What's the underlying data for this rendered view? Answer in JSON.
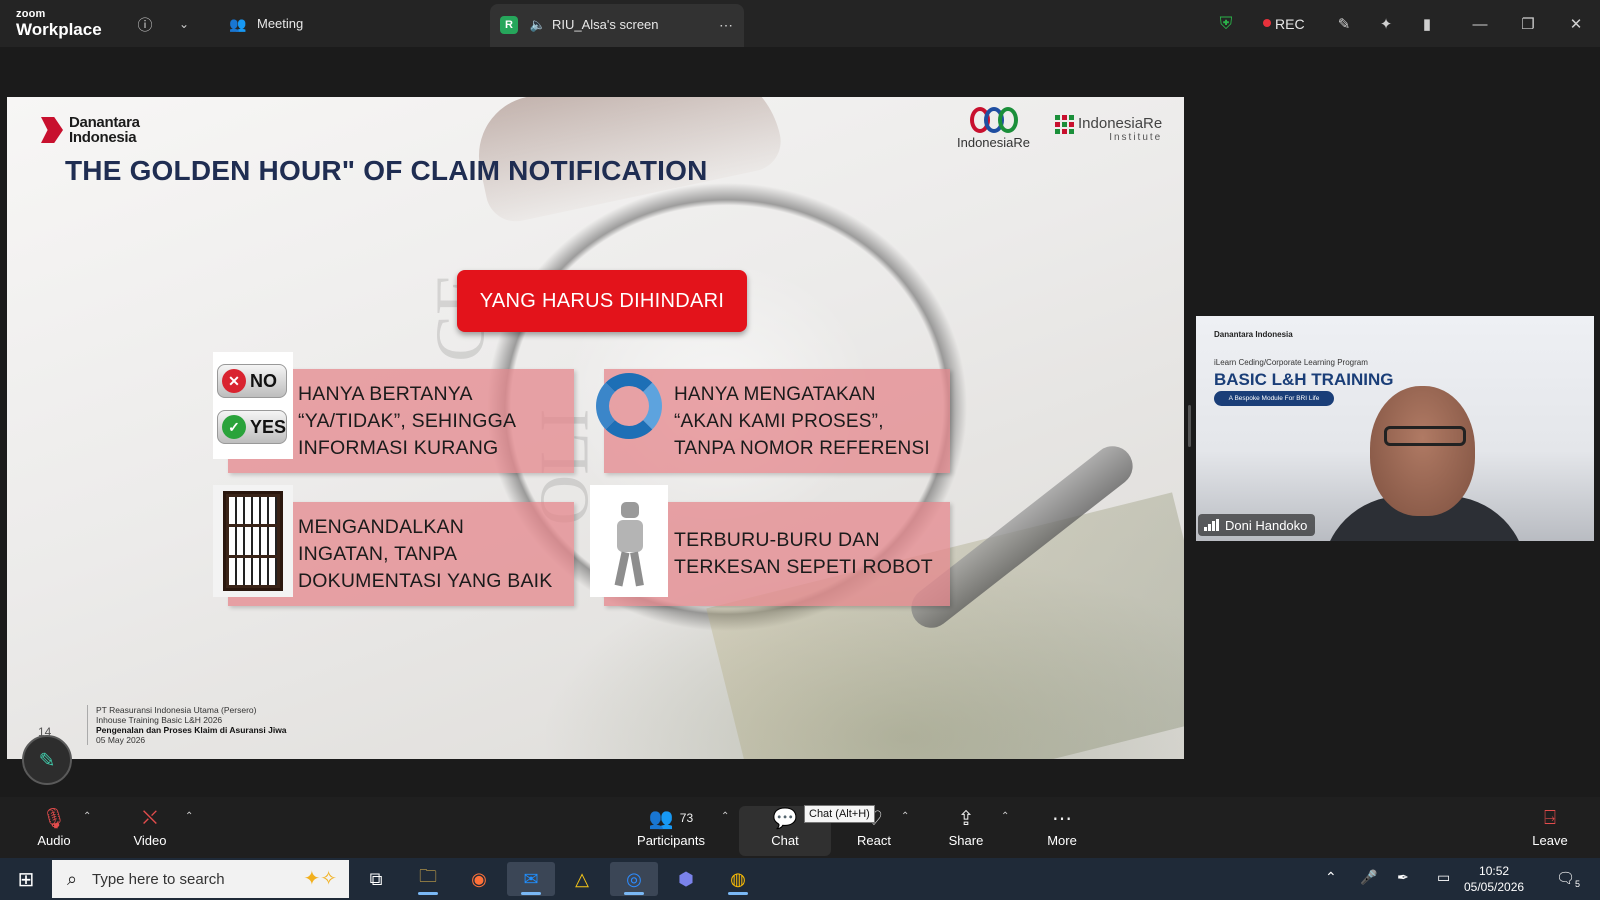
{
  "titlebar": {
    "brand_top": "zoom",
    "brand_bottom": "Workplace",
    "meeting_label": "Meeting",
    "shared_screen_badge": "R",
    "shared_screen_label": "RIU_Alsa's screen",
    "rec_label": "REC",
    "icons": [
      "info-icon",
      "chevron-down-icon",
      "meeting-people-icon",
      "speaker-icon",
      "more-options-icon",
      "shield-check-icon",
      "pen-icon",
      "sparkle-icon",
      "share-panel-icon",
      "minimize-icon",
      "restore-icon",
      "close-icon"
    ]
  },
  "slide": {
    "logo_left": "Danantara\nIndonesia",
    "title": "THE GOLDEN HOUR\" OF CLAIM NOTIFICATION",
    "logo_right_1": "IndonesiaRe",
    "logo_right_2": "IndonesiaRe",
    "logo_right_2_sub": "Institute",
    "avoid_label": "YANG HARUS DIHINDARI",
    "no_label": "NO",
    "yes_label": "YES",
    "card1": "HANYA BERTANYA\n“YA/TIDAK”, SEHINGGA\nINFORMASI KURANG",
    "card2": "HANYA MENGATAKAN\n“AKAN KAMI PROSES”,\nTANPA NOMOR REFERENSI",
    "card3": "MENGANDALKAN\nINGATAN, TANPA\nDOKUMENTASI YANG BAIK",
    "card4": "TERBURU-BURU DAN\nTERKESAN SEPETI ROBOT",
    "footer_company": "PT Reasuransi Indonesia Utama (Persero)",
    "footer_program": "Inhouse Training Basic L&H 2026",
    "footer_topic": "Pengenalan dan Proses Klaim di Asuransi Jiwa",
    "footer_date": "05 May 2026",
    "page_number": "14"
  },
  "video": {
    "bg_logo": "Danantara Indonesia",
    "bg_subtitle": "iLearn Ceding/Corporate Learning Program",
    "bg_title": "BASIC L&H TRAINING",
    "bg_pill": "A Bespoke Module For BRI Life",
    "participant_name": "Doni Handoko"
  },
  "toolbar": {
    "audio": "Audio",
    "video": "Video",
    "participants": "Participants",
    "participants_count": "73",
    "chat": "Chat",
    "chat_tooltip": "Chat (Alt+H)",
    "react": "React",
    "share": "Share",
    "more": "More",
    "leave": "Leave"
  },
  "taskbar": {
    "search_placeholder": "Type here to search",
    "time": "10:52",
    "date": "05/05/2026",
    "notification_count": "5"
  },
  "colors": {
    "slide_title": "#1f2d52",
    "avoid_button": "#e3131b",
    "card_fill": "#e4878c",
    "rec_dot": "#e7313b",
    "shield": "#2bb54a"
  }
}
